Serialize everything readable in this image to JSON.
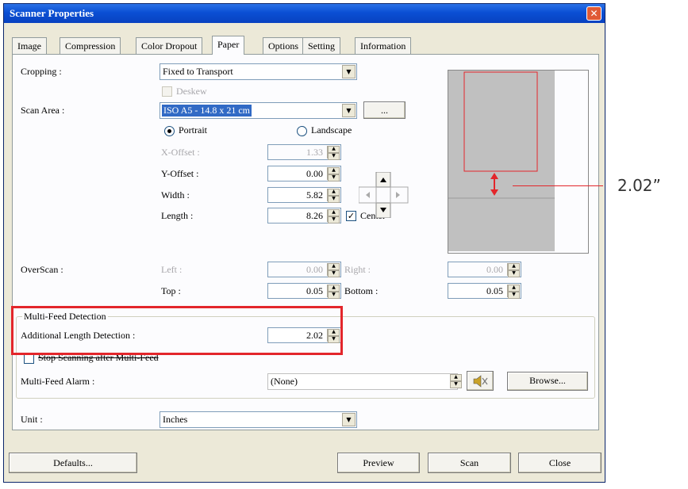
{
  "window": {
    "title": "Scanner Properties"
  },
  "tabs": [
    "Image",
    "Compression",
    "Color Dropout",
    "Paper",
    "Options",
    "Setting",
    "Information"
  ],
  "active_tab": "Paper",
  "paper": {
    "cropping_label": "Cropping :",
    "cropping_value": "Fixed to Transport",
    "deskew_label": "Deskew",
    "scan_area_label": "Scan Area :",
    "scan_area_value": "ISO A5 - 14.8 x 21 cm",
    "browse_small": "...",
    "portrait_label": "Portrait",
    "landscape_label": "Landscape",
    "x_offset_label": "X-Offset :",
    "x_offset_value": "1.33",
    "y_offset_label": "Y-Offset :",
    "y_offset_value": "0.00",
    "width_label": "Width :",
    "width_value": "5.82",
    "length_label": "Length :",
    "length_value": "8.26",
    "center_label": "Center",
    "overscan_label": "OverScan :",
    "left_label": "Left :",
    "left_value": "0.00",
    "right_label": "Right :",
    "right_value": "0.00",
    "top_label": "Top :",
    "top_value": "0.05",
    "bottom_label": "Bottom :",
    "bottom_value": "0.05"
  },
  "multifeed": {
    "group_label": "Multi-Feed Detection",
    "additional_label": "Additional Length Detection :",
    "additional_value": "2.02",
    "stop_label": "Stop Scanning after Multi-Feed",
    "alarm_label": "Multi-Feed Alarm :",
    "alarm_value": "(None)",
    "browse_label": "Browse..."
  },
  "unit": {
    "label": "Unit :",
    "value": "Inches"
  },
  "footer": {
    "defaults": "Defaults...",
    "preview": "Preview",
    "scan": "Scan",
    "close": "Close"
  },
  "callout": {
    "text": "2.02”"
  },
  "colors": {
    "highlight": "#e3262b",
    "title_blue": "#0a4fd4"
  }
}
